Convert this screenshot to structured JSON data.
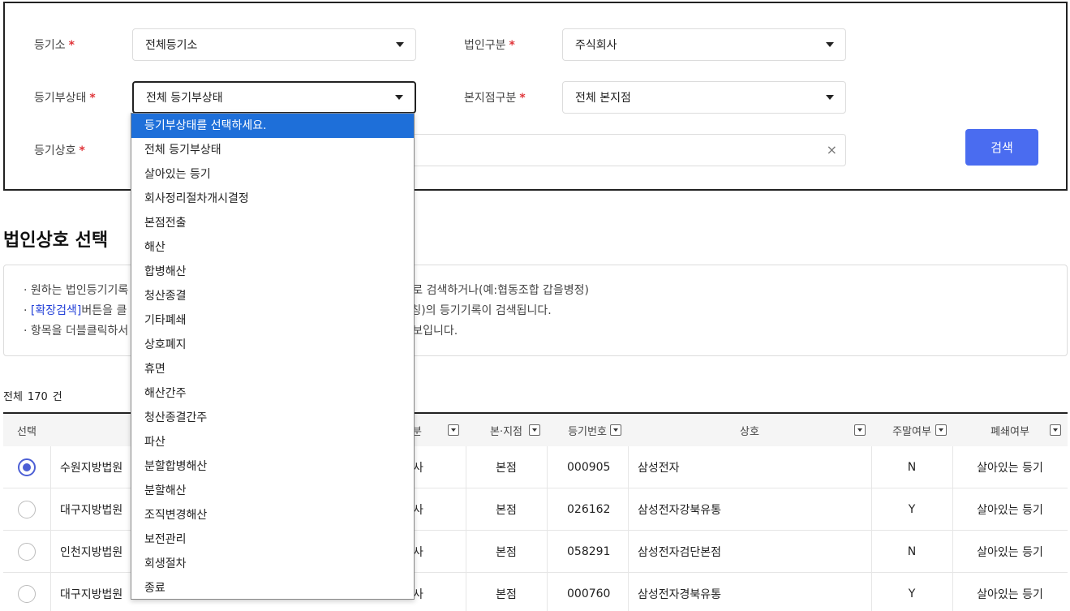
{
  "search": {
    "registry_label": "등기소",
    "registry_value": "전체등기소",
    "corp_type_label": "법인구분",
    "corp_type_value": "주식회사",
    "status_label": "등기부상태",
    "status_value": "전체 등기부상태",
    "branch_label": "본지점구분",
    "branch_value": "전체 본지점",
    "name_label": "등기상호",
    "required_mark": "*",
    "clear_icon": "×",
    "search_button": "검색"
  },
  "status_dropdown": {
    "options": [
      "등기부상태를 선택하세요.",
      "전체 등기부상태",
      "살아있는 등기",
      "회사정리절차개시결정",
      "본점전출",
      "해산",
      "합병해산",
      "청산종결",
      "기타폐쇄",
      "상호폐지",
      "휴면",
      "해산간주",
      "청산종결간주",
      "파산",
      "분할합병해산",
      "분할해산",
      "조직변경해산",
      "보전관리",
      "회생절차",
      "종료"
    ],
    "highlighted_index": 0
  },
  "section": {
    "title": "법인상호 선택"
  },
  "notice": {
    "line1_prefix": "· 원하는 법인등기기록",
    "line1_suffix": "로 검색하거나(예:협동조합 갑을병정)",
    "line2_bullet": "· ",
    "line2_link": "[확장검색]",
    "line2_mid": "버튼을 클",
    "line2_suffix": "칭)의 등기기록이 검색됩니다.",
    "line3_prefix": "· 항목을 더블클릭하서",
    "line3_suffix": "보입니다."
  },
  "total": {
    "prefix": "전체",
    "count": "170",
    "suffix": "건"
  },
  "table": {
    "headers": {
      "select": "선택",
      "corp_type_partial": "분",
      "branch": "본·지점",
      "reg_no": "등기번호",
      "name": "상호",
      "weekend": "주말여부",
      "closed": "폐쇄여부"
    },
    "rows": [
      {
        "court": "수원지방법원",
        "corp_type": "사",
        "branch": "본점",
        "reg_no": "000905",
        "name": "삼성전자",
        "weekend": "N",
        "closed": "살아있는 등기",
        "selected": true
      },
      {
        "court": "대구지방법원",
        "corp_type": "사",
        "branch": "본점",
        "reg_no": "026162",
        "name": "삼성전자강북유통",
        "weekend": "Y",
        "closed": "살아있는 등기",
        "selected": false
      },
      {
        "court": "인천지방법원",
        "corp_type": "사",
        "branch": "본점",
        "reg_no": "058291",
        "name": "삼성전자검단본점",
        "weekend": "N",
        "closed": "살아있는 등기",
        "selected": false
      },
      {
        "court": "대구지방법원",
        "corp_type": "사",
        "branch": "본점",
        "reg_no": "000760",
        "name": "삼성전자경북유통",
        "weekend": "Y",
        "closed": "살아있는 등기",
        "selected": false
      }
    ]
  },
  "colors": {
    "accent": "#4a6cf0",
    "required": "#e0353a",
    "dropdown_highlight": "#1e6fd9",
    "link": "#2340d8"
  }
}
